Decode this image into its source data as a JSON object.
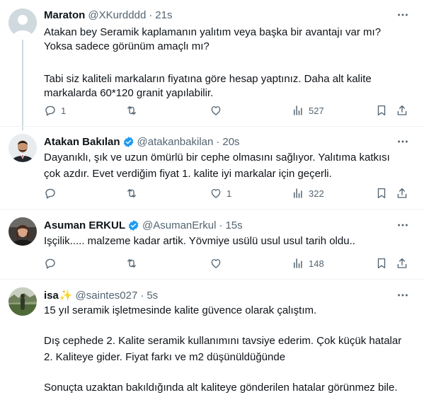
{
  "tweets": [
    {
      "name": "Maraton",
      "handle": "@XKurdddd",
      "time": "21s",
      "verified": false,
      "lines": [
        "Atakan bey Seramik kaplamanın yalıtım  veya başka bir avantajı var mı?",
        "Yoksa sadece görünüm amaçlı mı?",
        "",
        "Tabi siz kaliteli markaların fiyatına göre hesap yaptınız. Daha alt kalite",
        "markalarda  60*120 granit yapılabilir."
      ],
      "reply_count": "1",
      "retweet_count": "",
      "like_count": "",
      "views": "527"
    },
    {
      "name": "Atakan Bakılan",
      "handle": "@atakanbakilan",
      "time": "20s",
      "verified": true,
      "lines": [
        "Dayanıklı, şık ve uzun ömürlü bir cephe olmasını sağlıyor. Yalıtıma katkısı",
        "çok azdır. Evet verdiğim fiyat 1. kalite iyi markalar için geçerli."
      ],
      "reply_count": "",
      "retweet_count": "",
      "like_count": "1",
      "views": "322"
    },
    {
      "name": "Asuman ERKUL",
      "handle": "@AsumanErkul",
      "time": "15s",
      "verified": true,
      "lines": [
        "Işçilik..... malzeme kadar artik. Yövmiye usülü usul usul tarih oldu.."
      ],
      "reply_count": "",
      "retweet_count": "",
      "like_count": "",
      "views": "148"
    },
    {
      "name": "isa",
      "name_emoji": "✨",
      "handle": "@saintes027",
      "time": "5s",
      "verified": false,
      "lines": [
        "15 yıl seramik işletmesinde kalite güvence olarak çalıştım.",
        "",
        "Dış cephede 2. Kalite seramik kullanımını tavsiye ederim. Çok küçük hatalar",
        "2. Kaliteye gider. Fiyat farkı ve m2 düşünüldüğünde",
        "",
        "Sonuçta uzaktan bakıldığında alt kaliteye gönderilen hatalar görünmez bile."
      ]
    }
  ],
  "colors": {
    "text": "#0f1419",
    "muted": "#536471",
    "verified": "#1d9bf0",
    "divider": "#eff3f4",
    "thread_line": "#cfd9de",
    "sparkle": "#f5b800"
  }
}
